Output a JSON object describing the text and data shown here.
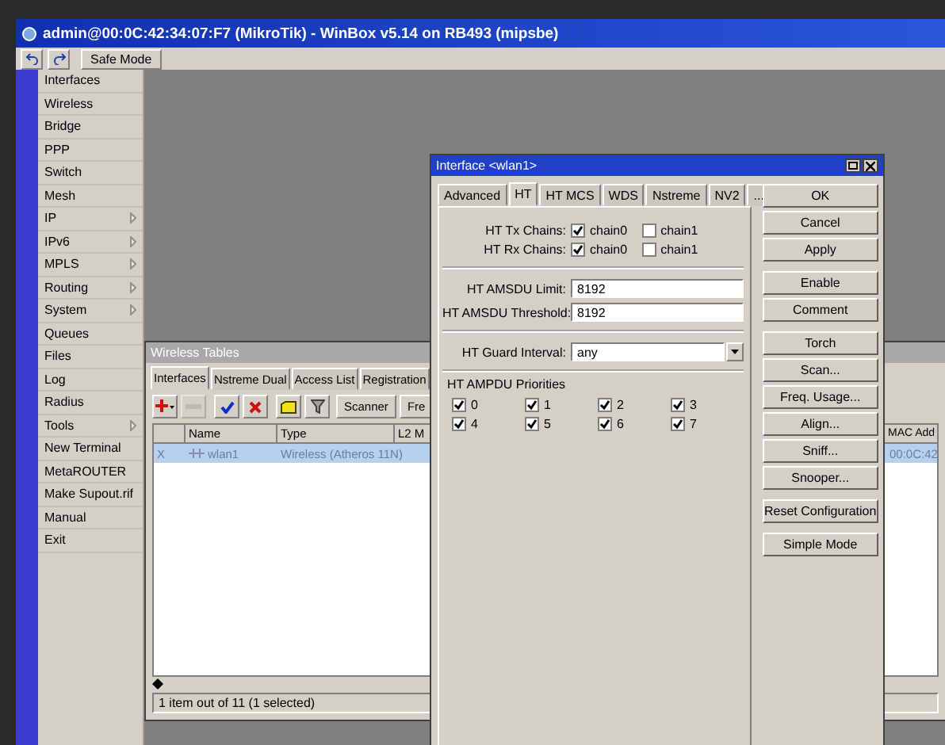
{
  "window": {
    "title": "admin@00:0C:42:34:07:F7 (MikroTik) - WinBox v5.14 on RB493 (mipsbe)"
  },
  "toolbar": {
    "safe_mode": "Safe Mode"
  },
  "sidebar": {
    "items": [
      {
        "label": "Interfaces",
        "submenu": false
      },
      {
        "label": "Wireless",
        "submenu": false
      },
      {
        "label": "Bridge",
        "submenu": false
      },
      {
        "label": "PPP",
        "submenu": false
      },
      {
        "label": "Switch",
        "submenu": false
      },
      {
        "label": "Mesh",
        "submenu": false
      },
      {
        "label": "IP",
        "submenu": true
      },
      {
        "label": "IPv6",
        "submenu": true
      },
      {
        "label": "MPLS",
        "submenu": true
      },
      {
        "label": "Routing",
        "submenu": true
      },
      {
        "label": "System",
        "submenu": true
      },
      {
        "label": "Queues",
        "submenu": false
      },
      {
        "label": "Files",
        "submenu": false
      },
      {
        "label": "Log",
        "submenu": false
      },
      {
        "label": "Radius",
        "submenu": false
      },
      {
        "label": "Tools",
        "submenu": true
      },
      {
        "label": "New Terminal",
        "submenu": false
      },
      {
        "label": "MetaROUTER",
        "submenu": false
      },
      {
        "label": "Make Supout.rif",
        "submenu": false
      },
      {
        "label": "Manual",
        "submenu": false
      },
      {
        "label": "Exit",
        "submenu": false
      }
    ]
  },
  "wireless_tables": {
    "title": "Wireless Tables",
    "tabs": [
      {
        "label": "Interfaces",
        "selected": true
      },
      {
        "label": "Nstreme Dual",
        "selected": false
      },
      {
        "label": "Access List",
        "selected": false
      },
      {
        "label": "Registration",
        "selected": false
      }
    ],
    "tool_icons": [
      {
        "kind": "add",
        "disabled": false
      },
      {
        "kind": "remove",
        "disabled": true
      },
      {
        "kind": "enable",
        "disabled": false
      },
      {
        "kind": "disable",
        "disabled": false
      },
      {
        "kind": "comment",
        "disabled": false
      },
      {
        "kind": "filter",
        "disabled": false
      }
    ],
    "buttons": [
      "Scanner",
      "Fre"
    ],
    "columns": [
      "Name",
      "Type",
      "L2 M",
      "MAC Add"
    ],
    "rows": [
      {
        "flag": "X",
        "name": "wlan1",
        "type": "Wireless (Atheros 11N)",
        "mac": "00:0C:42",
        "selected": true,
        "disabled": true
      }
    ],
    "status": "1 item out of 11 (1 selected)"
  },
  "interface_dialog": {
    "title": "Interface <wlan1>",
    "tabs": [
      {
        "label": "Advanced",
        "selected": false
      },
      {
        "label": "HT",
        "selected": true
      },
      {
        "label": "HT MCS",
        "selected": false
      },
      {
        "label": "WDS",
        "selected": false
      },
      {
        "label": "Nstreme",
        "selected": false
      },
      {
        "label": "NV2",
        "selected": false
      },
      {
        "label": "...",
        "selected": false
      }
    ],
    "field_groups": [
      [
        {
          "kind": "chains",
          "label": "HT Tx Chains:",
          "options": [
            {
              "label": "chain0",
              "checked": true
            },
            {
              "label": "chain1",
              "checked": false
            }
          ]
        },
        {
          "kind": "chains",
          "label": "HT Rx Chains:",
          "options": [
            {
              "label": "chain0",
              "checked": true
            },
            {
              "label": "chain1",
              "checked": false
            }
          ]
        }
      ],
      [
        {
          "kind": "text",
          "label": "HT AMSDU Limit:",
          "value": "8192"
        },
        {
          "kind": "text",
          "label": "HT AMSDU Threshold:",
          "value": "8192"
        }
      ],
      [
        {
          "kind": "select",
          "label": "HT Guard Interval:",
          "value": "any"
        }
      ]
    ],
    "priorities": {
      "title": "HT AMPDU Priorities",
      "items": [
        {
          "label": "0",
          "checked": true
        },
        {
          "label": "1",
          "checked": true
        },
        {
          "label": "2",
          "checked": true
        },
        {
          "label": "3",
          "checked": true
        },
        {
          "label": "4",
          "checked": true
        },
        {
          "label": "5",
          "checked": true
        },
        {
          "label": "6",
          "checked": true
        },
        {
          "label": "7",
          "checked": true
        }
      ]
    },
    "button_groups": [
      [
        "OK",
        "Cancel",
        "Apply"
      ],
      [
        "Enable",
        "Comment"
      ],
      [
        "Torch",
        "Scan...",
        "Freq. Usage...",
        "Align...",
        "Sniff...",
        "Snooper..."
      ],
      [
        "Reset Configuration"
      ],
      [
        "Simple Mode"
      ]
    ]
  }
}
